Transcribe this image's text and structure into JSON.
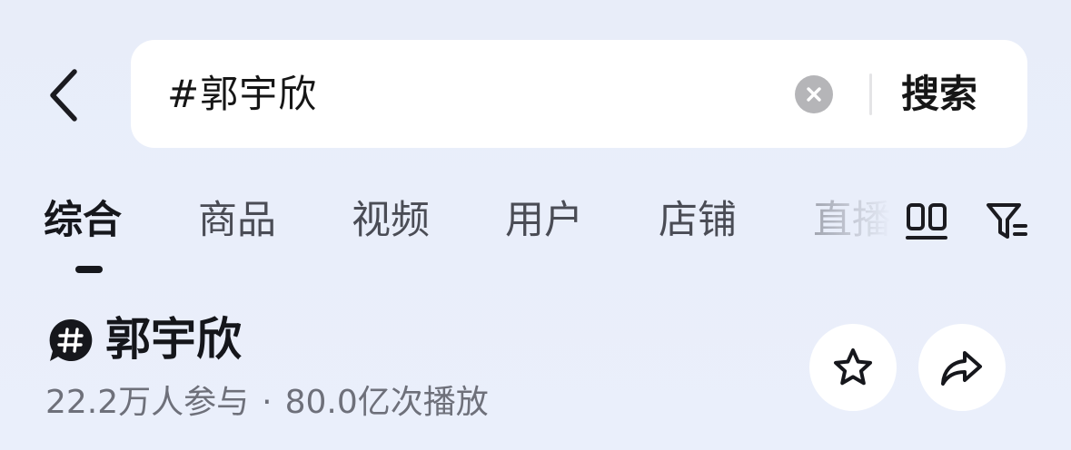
{
  "search": {
    "query": "#郭宇欣",
    "submit_label": "搜索"
  },
  "tabs": [
    {
      "label": "综合",
      "active": true
    },
    {
      "label": "商品",
      "active": false
    },
    {
      "label": "视频",
      "active": false
    },
    {
      "label": "用户",
      "active": false
    },
    {
      "label": "店铺",
      "active": false
    },
    {
      "label": "直播",
      "active": false
    }
  ],
  "topic": {
    "title": "郭宇欣",
    "participants": "22.2万人参与",
    "separator": "·",
    "plays": "80.0亿次播放"
  },
  "icons": {
    "back": "chevron-left-icon",
    "clear": "clear-circle-icon",
    "grid": "layout-grid-icon",
    "filter": "filter-icon",
    "topic": "hashtag-bubble-icon",
    "favorite": "star-icon",
    "share": "share-arrow-icon"
  },
  "colors": {
    "background": "#e8edf9",
    "text_primary": "#16171c",
    "text_secondary": "#6e707a",
    "clear_icon": "#b5b5b8"
  }
}
